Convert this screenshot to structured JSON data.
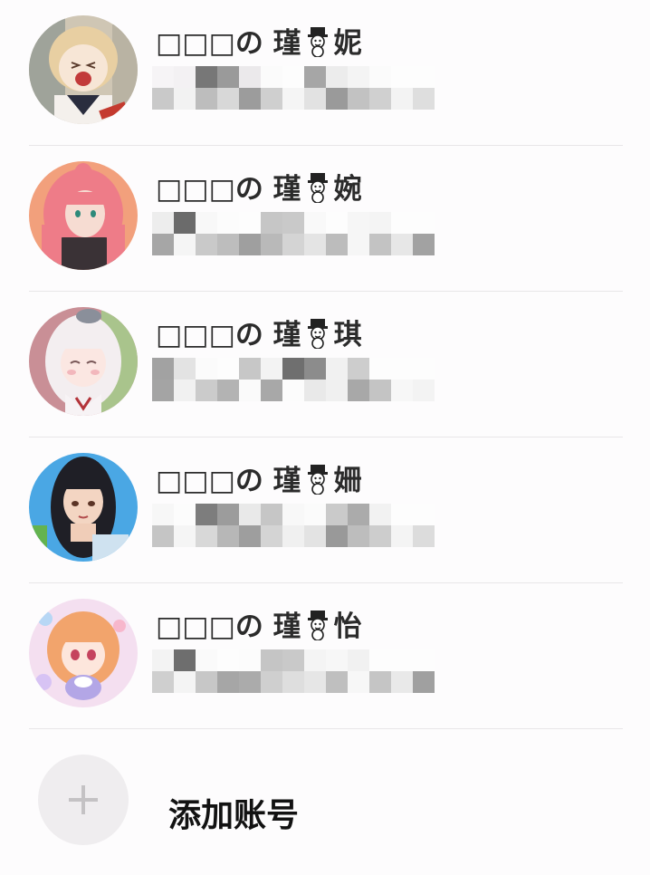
{
  "accounts": [
    {
      "name_prefix": "□□□の 瑾",
      "name_suffix": "妮",
      "avatar_icon": "anime-avatar-blonde-girl-icon",
      "detail_masked": true
    },
    {
      "name_prefix": "□□□の 瑾",
      "name_suffix": "婉",
      "avatar_icon": "anime-avatar-pink-hair-girl-icon",
      "detail_masked": true
    },
    {
      "name_prefix": "□□□の 瑾",
      "name_suffix": "琪",
      "avatar_icon": "anime-avatar-white-hair-girl-icon",
      "detail_masked": true
    },
    {
      "name_prefix": "□□□の 瑾",
      "name_suffix": "姍",
      "avatar_icon": "anime-avatar-dark-hair-girl-icon",
      "detail_masked": true
    },
    {
      "name_prefix": "□□□の 瑾",
      "name_suffix": "怡",
      "avatar_icon": "anime-avatar-orange-hair-girl-icon",
      "detail_masked": true
    }
  ],
  "add_account": {
    "label": "添加账号",
    "icon": "plus-icon"
  },
  "colors": {
    "background": "#fdfcfd",
    "divider": "#e8e6e8",
    "name_text": "#2b2b2b",
    "add_circle": "#efedef",
    "plus": "#c4c2c4"
  }
}
